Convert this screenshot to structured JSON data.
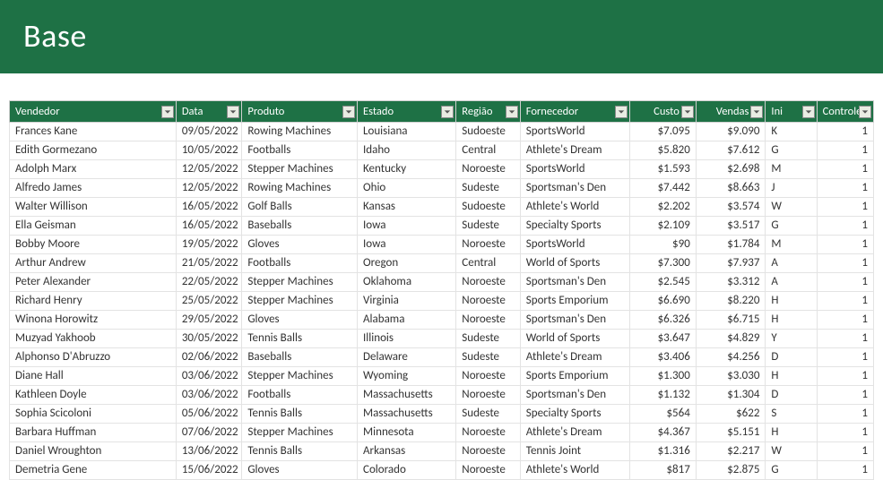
{
  "banner": {
    "title": "Base"
  },
  "columns": [
    {
      "key": "vendedor",
      "label": "Vendedor",
      "type": "text"
    },
    {
      "key": "data",
      "label": "Data",
      "type": "date"
    },
    {
      "key": "produto",
      "label": "Produto",
      "type": "text"
    },
    {
      "key": "estado",
      "label": "Estado",
      "type": "text"
    },
    {
      "key": "regiao",
      "label": "Região",
      "type": "text"
    },
    {
      "key": "fornecedor",
      "label": "Fornecedor",
      "type": "text"
    },
    {
      "key": "custo",
      "label": "Custo",
      "type": "num"
    },
    {
      "key": "vendas",
      "label": "Vendas",
      "type": "num"
    },
    {
      "key": "ini",
      "label": "Ini",
      "type": "text"
    },
    {
      "key": "controle",
      "label": "Controle",
      "type": "num"
    }
  ],
  "rows": [
    {
      "vendedor": "Frances Kane",
      "data": "09/05/2022",
      "produto": "Rowing Machines",
      "estado": "Louisiana",
      "regiao": "Sudoeste",
      "fornecedor": "SportsWorld",
      "custo": "$7.095",
      "vendas": "$9.090",
      "ini": "K",
      "controle": "1"
    },
    {
      "vendedor": "Edith Gormezano",
      "data": "10/05/2022",
      "produto": "Footballs",
      "estado": "Idaho",
      "regiao": "Central",
      "fornecedor": "Athlete's Dream",
      "custo": "$5.820",
      "vendas": "$7.612",
      "ini": "G",
      "controle": "1"
    },
    {
      "vendedor": "Adolph Marx",
      "data": "12/05/2022",
      "produto": "Stepper Machines",
      "estado": "Kentucky",
      "regiao": "Noroeste",
      "fornecedor": "SportsWorld",
      "custo": "$1.593",
      "vendas": "$2.698",
      "ini": "M",
      "controle": "1"
    },
    {
      "vendedor": "Alfredo James",
      "data": "12/05/2022",
      "produto": "Rowing Machines",
      "estado": "Ohio",
      "regiao": "Sudeste",
      "fornecedor": "Sportsman's Den",
      "custo": "$7.442",
      "vendas": "$8.663",
      "ini": "J",
      "controle": "1"
    },
    {
      "vendedor": "Walter Willison",
      "data": "16/05/2022",
      "produto": "Golf Balls",
      "estado": "Kansas",
      "regiao": "Sudoeste",
      "fornecedor": "Athlete's World",
      "custo": "$2.202",
      "vendas": "$3.574",
      "ini": "W",
      "controle": "1"
    },
    {
      "vendedor": "Ella Geisman",
      "data": "16/05/2022",
      "produto": "Baseballs",
      "estado": "Iowa",
      "regiao": "Sudeste",
      "fornecedor": "Specialty Sports",
      "custo": "$2.109",
      "vendas": "$3.517",
      "ini": "G",
      "controle": "1"
    },
    {
      "vendedor": "Bobby Moore",
      "data": "19/05/2022",
      "produto": "Gloves",
      "estado": "Iowa",
      "regiao": "Noroeste",
      "fornecedor": "SportsWorld",
      "custo": "$90",
      "vendas": "$1.784",
      "ini": "M",
      "controle": "1"
    },
    {
      "vendedor": "Arthur Andrew",
      "data": "21/05/2022",
      "produto": "Footballs",
      "estado": "Oregon",
      "regiao": "Central",
      "fornecedor": "World of Sports",
      "custo": "$7.300",
      "vendas": "$7.937",
      "ini": "A",
      "controle": "1"
    },
    {
      "vendedor": "Peter Alexander",
      "data": "22/05/2022",
      "produto": "Stepper Machines",
      "estado": "Oklahoma",
      "regiao": "Noroeste",
      "fornecedor": "Sportsman's Den",
      "custo": "$2.545",
      "vendas": "$3.312",
      "ini": "A",
      "controle": "1"
    },
    {
      "vendedor": "Richard Henry",
      "data": "25/05/2022",
      "produto": "Stepper Machines",
      "estado": "Virginia",
      "regiao": "Noroeste",
      "fornecedor": "Sports Emporium",
      "custo": "$6.690",
      "vendas": "$8.220",
      "ini": "H",
      "controle": "1"
    },
    {
      "vendedor": "Winona Horowitz",
      "data": "29/05/2022",
      "produto": "Gloves",
      "estado": "Alabama",
      "regiao": "Noroeste",
      "fornecedor": "Sportsman's Den",
      "custo": "$6.326",
      "vendas": "$6.715",
      "ini": "H",
      "controle": "1"
    },
    {
      "vendedor": "Muzyad Yakhoob",
      "data": "30/05/2022",
      "produto": "Tennis Balls",
      "estado": "Illinois",
      "regiao": "Sudeste",
      "fornecedor": "World of Sports",
      "custo": "$3.647",
      "vendas": "$4.829",
      "ini": "Y",
      "controle": "1"
    },
    {
      "vendedor": "Alphonso D'Abruzzo",
      "data": "02/06/2022",
      "produto": "Baseballs",
      "estado": "Delaware",
      "regiao": "Sudeste",
      "fornecedor": "Athlete's Dream",
      "custo": "$3.406",
      "vendas": "$4.256",
      "ini": "D",
      "controle": "1"
    },
    {
      "vendedor": "Diane Hall",
      "data": "03/06/2022",
      "produto": "Stepper Machines",
      "estado": "Wyoming",
      "regiao": "Noroeste",
      "fornecedor": "Sports Emporium",
      "custo": "$1.300",
      "vendas": "$3.030",
      "ini": "H",
      "controle": "1"
    },
    {
      "vendedor": "Kathleen Doyle",
      "data": "03/06/2022",
      "produto": "Footballs",
      "estado": "Massachusetts",
      "regiao": "Noroeste",
      "fornecedor": "Sportsman's Den",
      "custo": "$1.132",
      "vendas": "$1.304",
      "ini": "D",
      "controle": "1"
    },
    {
      "vendedor": "Sophia Scicoloni",
      "data": "05/06/2022",
      "produto": "Tennis Balls",
      "estado": "Massachusetts",
      "regiao": "Sudeste",
      "fornecedor": "Specialty Sports",
      "custo": "$564",
      "vendas": "$622",
      "ini": "S",
      "controle": "1"
    },
    {
      "vendedor": "Barbara Huffman",
      "data": "07/06/2022",
      "produto": "Stepper Machines",
      "estado": "Minnesota",
      "regiao": "Noroeste",
      "fornecedor": "Athlete's Dream",
      "custo": "$4.367",
      "vendas": "$5.151",
      "ini": "H",
      "controle": "1"
    },
    {
      "vendedor": "Daniel Wroughton",
      "data": "13/06/2022",
      "produto": "Tennis Balls",
      "estado": "Arkansas",
      "regiao": "Noroeste",
      "fornecedor": "Tennis Joint",
      "custo": "$1.316",
      "vendas": "$2.217",
      "ini": "W",
      "controle": "1"
    },
    {
      "vendedor": "Demetria Gene",
      "data": "15/06/2022",
      "produto": "Gloves",
      "estado": "Colorado",
      "regiao": "Noroeste",
      "fornecedor": "Athlete's World",
      "custo": "$817",
      "vendas": "$2.875",
      "ini": "G",
      "controle": "1"
    }
  ]
}
